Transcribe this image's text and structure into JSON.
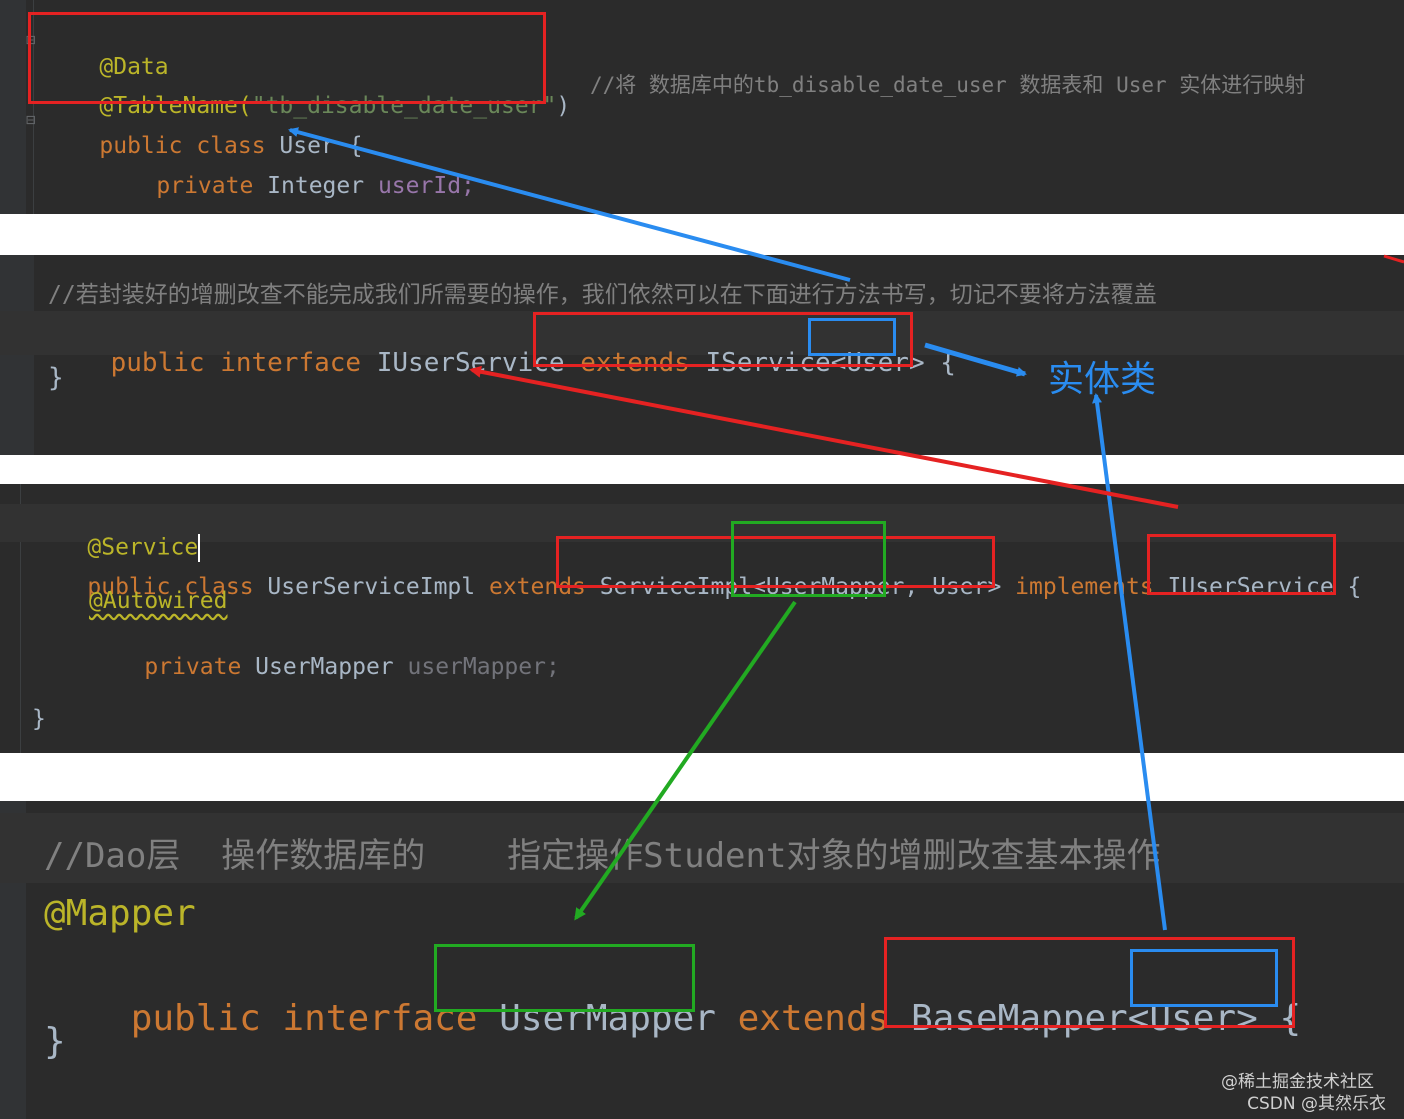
{
  "panel1": {
    "line1": "@Data",
    "line2_ann": "@TableName(",
    "line2_str": "\"tb_disable_date_user\"",
    "line2_close": ")",
    "line2_comment": "//将 数据库中的tb_disable_date_user 数据表和 User 实体进行映射",
    "line3_kw": "public class ",
    "line3_name": "User {",
    "line4_kw": "private ",
    "line4_type": "Integer ",
    "line4_field": "userId;"
  },
  "panel2": {
    "comment": "//若封装好的增删改查不能完成我们所需要的操作，我们依然可以在下面进行方法书写，切记不要将方法覆盖",
    "decl_kw": "public interface ",
    "decl_name": "IUserService ",
    "decl_extends": "extends ",
    "decl_type": "IService<User> {",
    "close": "}"
  },
  "panel3": {
    "ann": "@Service",
    "decl_kw": "public class ",
    "decl_name": "UserServiceImpl ",
    "decl_extends": "extends ",
    "decl_super": "ServiceImpl<UserMapper, User> ",
    "decl_impl": "implements ",
    "decl_iface": "IUserService {",
    "autowired": "@Autowired",
    "field_kw": "private ",
    "field_type": "UserMapper ",
    "field_name": "userMapper;",
    "close": "}"
  },
  "panel4": {
    "comment": "//Dao层  操作数据库的    指定操作Student对象的增删改查基本操作",
    "ann": "@Mapper",
    "decl_kw": "public interface ",
    "decl_name": "UserMapper ",
    "decl_extends": "extends ",
    "decl_type": "BaseMapper<User> {",
    "close": "}"
  },
  "callout": "实体类",
  "watermark": {
    "line1": "@稀土掘金技术社区",
    "line2": "CSDN @其然乐衣"
  },
  "colors": {
    "editor_bg": "#2b2b2b",
    "keyword": "#cc7832",
    "annotation": "#bbb529",
    "string": "#6a8759",
    "comment": "#808080",
    "box_red": "#e52222",
    "box_blue": "#2a8cf0",
    "box_green": "#22aa22"
  }
}
